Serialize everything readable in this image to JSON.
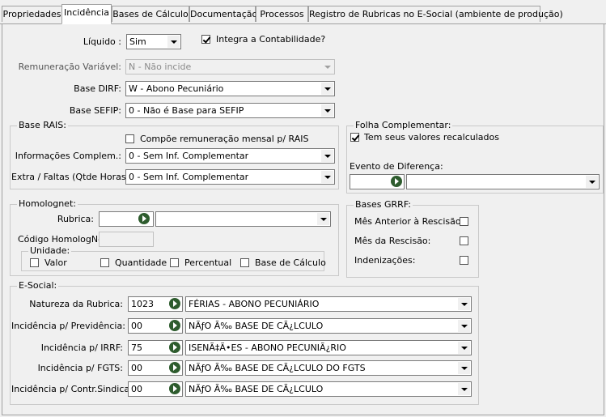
{
  "tabs": [
    "Propriedades",
    "Incidência",
    "Bases de Cálculo",
    "Documentação",
    "Processos",
    "Registro de Rubricas no E-Social (ambiente de produção)"
  ],
  "top": {
    "liquido_label": "Líquido :",
    "liquido_value": "Sim",
    "integra_label": "Integra a Contabilidade?",
    "integra_checked": true,
    "remun_label": "Remuneração Variável:",
    "remun_value": "N - Não incide",
    "dirf_label": "Base DIRF:",
    "dirf_value": "W - Abono Pecuniário",
    "sefip_label": "Base SEFIP:",
    "sefip_value": "0 - Não é Base para SEFIP"
  },
  "rais": {
    "title": "Base RAIS:",
    "compoe_label": "Compõe remuneração mensal p/ RAIS",
    "compoe_checked": false,
    "info_label": "Informações Complem.:",
    "info_value": "0 - Sem Inf. Complementar",
    "extra_label": "Extra / Faltas (Qtde Horas):",
    "extra_value": "0 - Sem Inf. Complementar"
  },
  "folha": {
    "title": "Folha Complementar:",
    "recalc_label": "Tem seus valores recalculados",
    "recalc_checked": true,
    "evento_label": "Evento de Diferença:",
    "evento_code": "",
    "evento_value": ""
  },
  "homolog": {
    "title": "Homolognet:",
    "rubrica_label": "Rubrica:",
    "rubrica_code": "",
    "rubrica_value": "",
    "codigo_label": "Código HomologNet",
    "codigo_value": "",
    "unidade_title": "Unidade:",
    "unidades": [
      "Valor",
      "Quantidade",
      "Percentual",
      "Base de Cálculo"
    ]
  },
  "grrf": {
    "title": "Bases GRRF:",
    "items": [
      "Mês Anterior à Rescisão:",
      "Mês da Rescisão:",
      "Indenizações:"
    ]
  },
  "esocial": {
    "title": "E-Social:",
    "rows": [
      {
        "label": "Natureza da Rubrica:",
        "code": "1023",
        "value": "FÉRIAS - ABONO PECUNIÁRIO"
      },
      {
        "label": "Incidência p/ Previdência:",
        "code": "00",
        "value": "NÃƒO Ã‰ BASE DE CÃ¿LCULO"
      },
      {
        "label": "Incidência p/ IRRF:",
        "code": "75",
        "value": "ISENÃ‡Ã•ES - ABONO PECUNIÃ¿RIO"
      },
      {
        "label": "Incidência p/ FGTS:",
        "code": "00",
        "value": "NÃƒO Ã‰ BASE DE CÃ¿LCULO DO FGTS"
      },
      {
        "label": "Incidência p/ Contr.Sindical:",
        "code": "00",
        "value": "NÃƒO Ã‰ BASE DE CÃ¿LCULO"
      }
    ]
  }
}
